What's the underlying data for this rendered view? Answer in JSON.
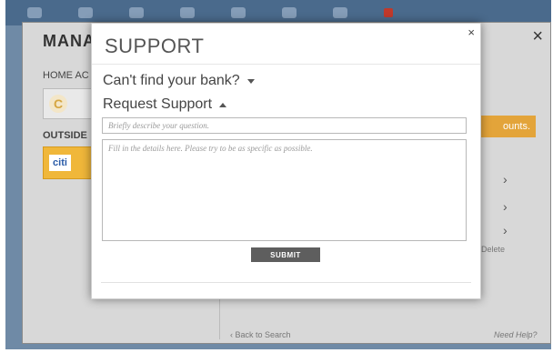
{
  "background": {
    "title": "MANAG",
    "close_symbol": "×",
    "home_label": "HOME AC",
    "outside_label": "OUTSIDE",
    "account_initial": "C",
    "citi_logo": "citi",
    "right_button_label": "ounts.",
    "chevron": "›",
    "delete_label": "Delete",
    "back_label": "‹ Back to Search",
    "help_label": "Need Help?"
  },
  "modal": {
    "title": "SUPPORT",
    "close_symbol": "×",
    "cant_find_label": "Can't find your bank?",
    "request_label": "Request Support",
    "subject_placeholder": "Briefly describe your question.",
    "details_placeholder": "Fill in the details here. Please try to be as specific as possible.",
    "subject_value": "",
    "details_value": "",
    "submit_label": "SUBMIT"
  },
  "colors": {
    "accent_orange": "#f0b73a",
    "submit_bg": "#5e5e5e",
    "frame_blue": "#4a6a8c"
  }
}
